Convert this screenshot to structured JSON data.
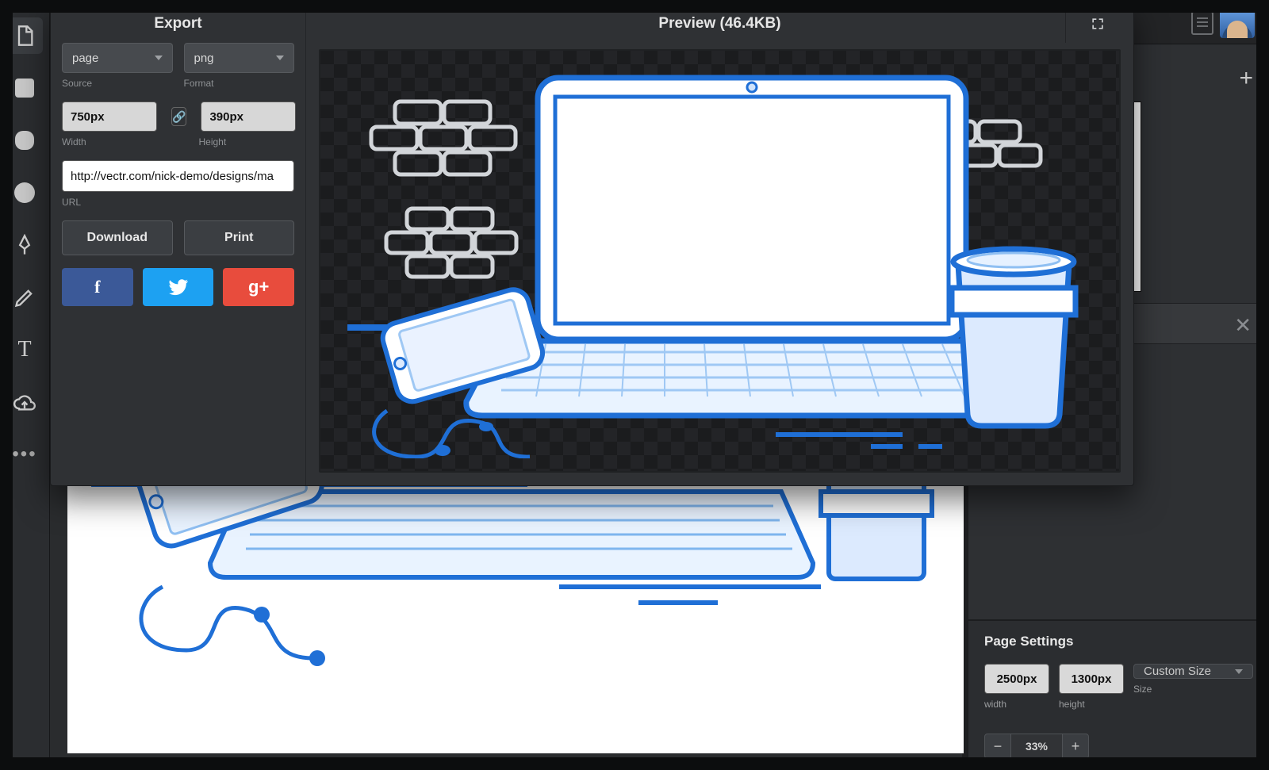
{
  "export": {
    "title": "Export",
    "source": {
      "value": "page",
      "label": "Source"
    },
    "format": {
      "value": "png",
      "label": "Format"
    },
    "width": {
      "value": "750px",
      "label": "Width"
    },
    "height": {
      "value": "390px",
      "label": "Height"
    },
    "url": {
      "value": "http://vectr.com/nick-demo/designs/ma",
      "label": "URL"
    },
    "download": "Download",
    "print": "Print"
  },
  "preview": {
    "title": "Preview (46.4KB)"
  },
  "page_settings": {
    "title": "Page Settings",
    "width": {
      "value": "2500px",
      "label": "width"
    },
    "height": {
      "value": "1300px",
      "label": "height"
    },
    "size_select": {
      "value": "Custom Size",
      "label": "Size"
    },
    "zoom": "33%"
  },
  "social": {
    "f": "f",
    "t": "t",
    "g": "g+"
  },
  "icons": {
    "plus": "+",
    "close": "✕",
    "link": "🔗"
  }
}
